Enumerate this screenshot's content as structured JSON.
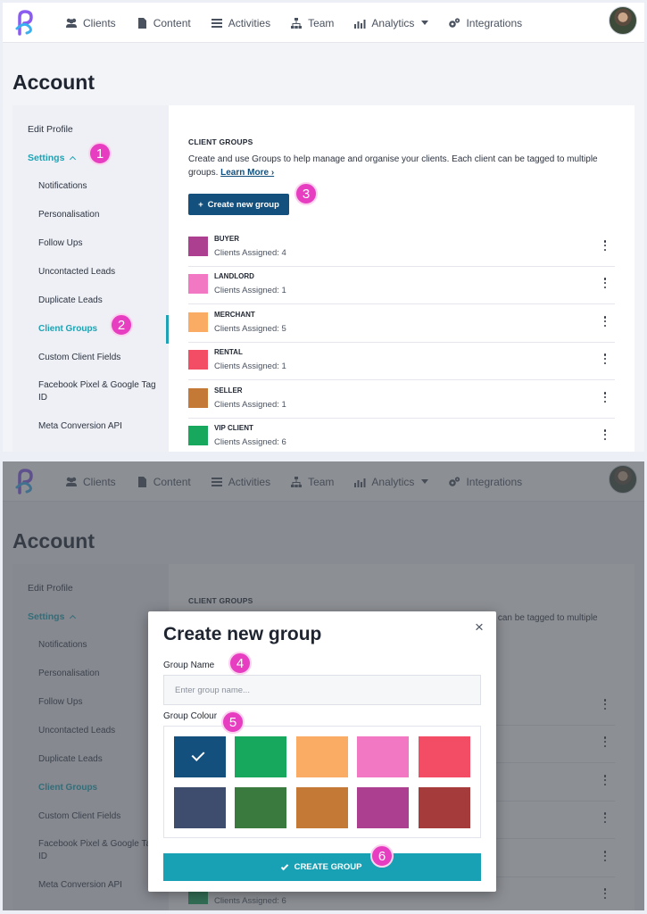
{
  "nav": {
    "items": [
      {
        "label": "Clients",
        "icon": "users-icon"
      },
      {
        "label": "Content",
        "icon": "file-icon"
      },
      {
        "label": "Activities",
        "icon": "list-icon"
      },
      {
        "label": "Team",
        "icon": "sitemap-icon"
      },
      {
        "label": "Analytics",
        "icon": "bar-chart-icon"
      },
      {
        "label": "Integrations",
        "icon": "cogs-icon"
      }
    ]
  },
  "page": {
    "title": "Account"
  },
  "sidebar": {
    "edit_profile": "Edit Profile",
    "settings": "Settings",
    "items": [
      "Notifications",
      "Personalisation",
      "Follow Ups",
      "Uncontacted Leads",
      "Duplicate Leads",
      "Client Groups",
      "Custom Client Fields",
      "Facebook Pixel & Google Tag ID",
      "Meta Conversion API"
    ]
  },
  "client_groups": {
    "title": "CLIENT GROUPS",
    "description": "Create and use Groups to help manage and organise your clients. Each client can be tagged to multiple groups.",
    "learn_more": "Learn More ›",
    "create_button": "Create new group",
    "groups": [
      {
        "name": "BUYER",
        "count": "Clients Assigned: 4",
        "color": "#ad3f91"
      },
      {
        "name": "LANDLORD",
        "count": "Clients Assigned: 1",
        "color": "#f278c4"
      },
      {
        "name": "MERCHANT",
        "count": "Clients Assigned: 5",
        "color": "#fbac64"
      },
      {
        "name": "RENTAL",
        "count": "Clients Assigned: 1",
        "color": "#f24d64"
      },
      {
        "name": "SELLER",
        "count": "Clients Assigned: 1",
        "color": "#c47a36"
      },
      {
        "name": "VIP CLIENT",
        "count": "Clients Assigned: 6",
        "color": "#17a85e"
      }
    ]
  },
  "modal": {
    "title": "Create new group",
    "name_label": "Group Name",
    "name_placeholder": "Enter group name...",
    "colour_label": "Group Colour",
    "colours": [
      "#14507e",
      "#17a85e",
      "#fbac64",
      "#f278c4",
      "#f24d64",
      "#3e4c6e",
      "#3b7a3f",
      "#c47a36",
      "#ad3f91",
      "#a63b3b"
    ],
    "selected_colour": 0,
    "submit": "CREATE GROUP"
  },
  "badges": [
    "1",
    "2",
    "3",
    "4",
    "5",
    "6"
  ],
  "colors": {
    "accent": "#1fa2b3",
    "primary_button": "#14507e",
    "badge": "#e73dc0"
  }
}
